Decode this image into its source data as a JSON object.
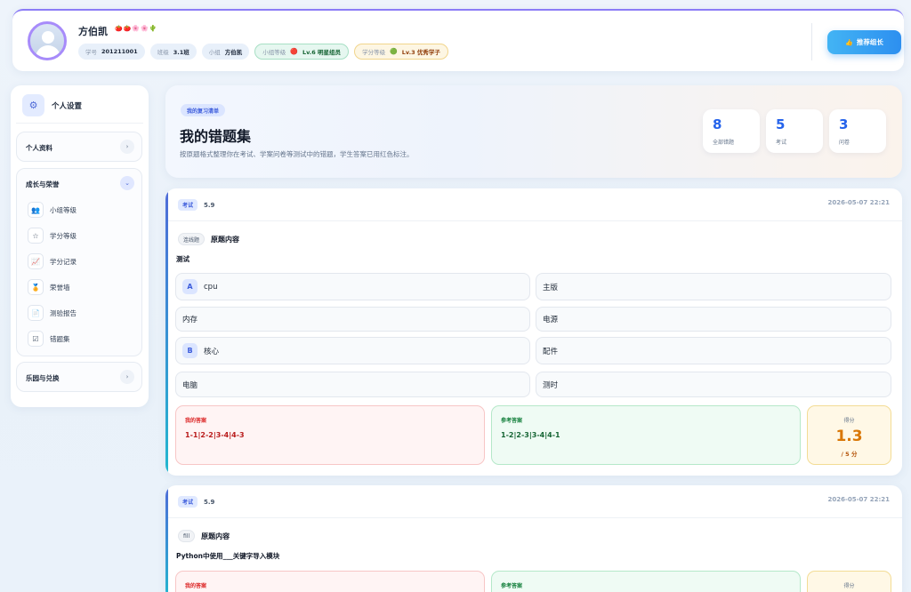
{
  "profile": {
    "name": "方伯凯",
    "badges": "🍅🍅🌸🌸🌵",
    "chips": [
      {
        "key": "学号",
        "value": "201211001"
      },
      {
        "key": "班级",
        "value": "3.1班"
      },
      {
        "key": "小组",
        "value": "方伯凯"
      },
      {
        "key": "小组等级",
        "gem": "🔴",
        "value": "Lv.6 明星组员"
      },
      {
        "key": "学分等级",
        "gem": "🟢",
        "value": "Lv.3 优秀学子"
      }
    ],
    "recommend_btn": "推荐组长",
    "recommend_icon": "👍"
  },
  "sidebar": {
    "title": "个人设置",
    "gear_icon": "⚙",
    "groups": [
      {
        "label": "个人资料",
        "arrow": "›"
      },
      {
        "label": "成长与荣誉",
        "arrow": "⌄"
      },
      {
        "label": "乐园与兑换",
        "arrow": "›"
      }
    ],
    "items": [
      {
        "label": "小组等级",
        "icon": "👥"
      },
      {
        "label": "学分等级",
        "icon": "☆"
      },
      {
        "label": "学分记录",
        "icon": "📈"
      },
      {
        "label": "荣誉墙",
        "icon": "🏅"
      },
      {
        "label": "测验报告",
        "icon": "📄"
      },
      {
        "label": "错题集",
        "icon": "☑"
      }
    ]
  },
  "hero": {
    "pill": "我的复习清单",
    "title": "我的错题集",
    "subtitle": "按原题格式整理你在考试、学案问卷等测试中的错题，学生答案已用红色标注。",
    "stats": [
      {
        "value": "8",
        "label": "全部错题"
      },
      {
        "value": "5",
        "label": "考试"
      },
      {
        "value": "3",
        "label": "问卷"
      }
    ]
  },
  "questions": [
    {
      "tag": "考试",
      "date_short": "5.9",
      "time": "2026-05-07 22:21",
      "type": "连线题",
      "orig_label": "原题内容",
      "stem": "测试",
      "options": [
        {
          "letter": "A",
          "text": "cpu"
        },
        {
          "letter": "",
          "text": "主版"
        },
        {
          "letter": "",
          "text": "内存"
        },
        {
          "letter": "",
          "text": "电源"
        },
        {
          "letter": "B",
          "text": "核心"
        },
        {
          "letter": "",
          "text": "配件"
        },
        {
          "letter": "",
          "text": "电脑"
        },
        {
          "letter": "",
          "text": "测时"
        }
      ],
      "my_answer_label": "我的答案",
      "my_answer": "1-1|2-2|3-4|4-3",
      "ref_answer_label": "参考答案",
      "ref_answer": "1-2|2-3|3-4|4-1",
      "score_label": "得分",
      "score": "1.3",
      "score_total": "/ 5 分"
    },
    {
      "tag": "考试",
      "date_short": "5.9",
      "time": "2026-05-07 22:21",
      "type": "fill",
      "orig_label": "原题内容",
      "stem": "Python中使用___关键字导入模块",
      "my_answer_label": "我的答案",
      "ref_answer_label": "参考答案",
      "score_label": "得分"
    }
  ]
}
